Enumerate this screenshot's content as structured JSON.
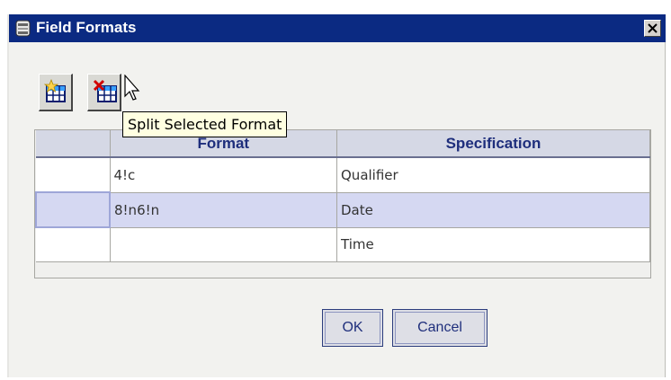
{
  "window": {
    "title": "Field Formats"
  },
  "toolbar": {
    "add_format_icon": "table-add-icon",
    "split_format_icon": "table-split-icon"
  },
  "tooltip": {
    "text": "Split Selected Format"
  },
  "grid": {
    "columns": [
      "",
      "Format",
      "Specification"
    ],
    "rows": [
      {
        "format": "4!c",
        "specification": "Qualifier",
        "selected": false
      },
      {
        "format": "8!n6!n",
        "specification": "Date",
        "selected": true
      },
      {
        "format": "",
        "specification": "Time",
        "selected": false
      }
    ]
  },
  "buttons": {
    "ok": "OK",
    "cancel": "Cancel"
  },
  "colors": {
    "titlebar": "#0b2a82",
    "header_bg": "#d5d8e5",
    "header_text": "#1e2e7c",
    "selected_row": "#d5d8f2",
    "tooltip_bg": "#ffffe1"
  }
}
